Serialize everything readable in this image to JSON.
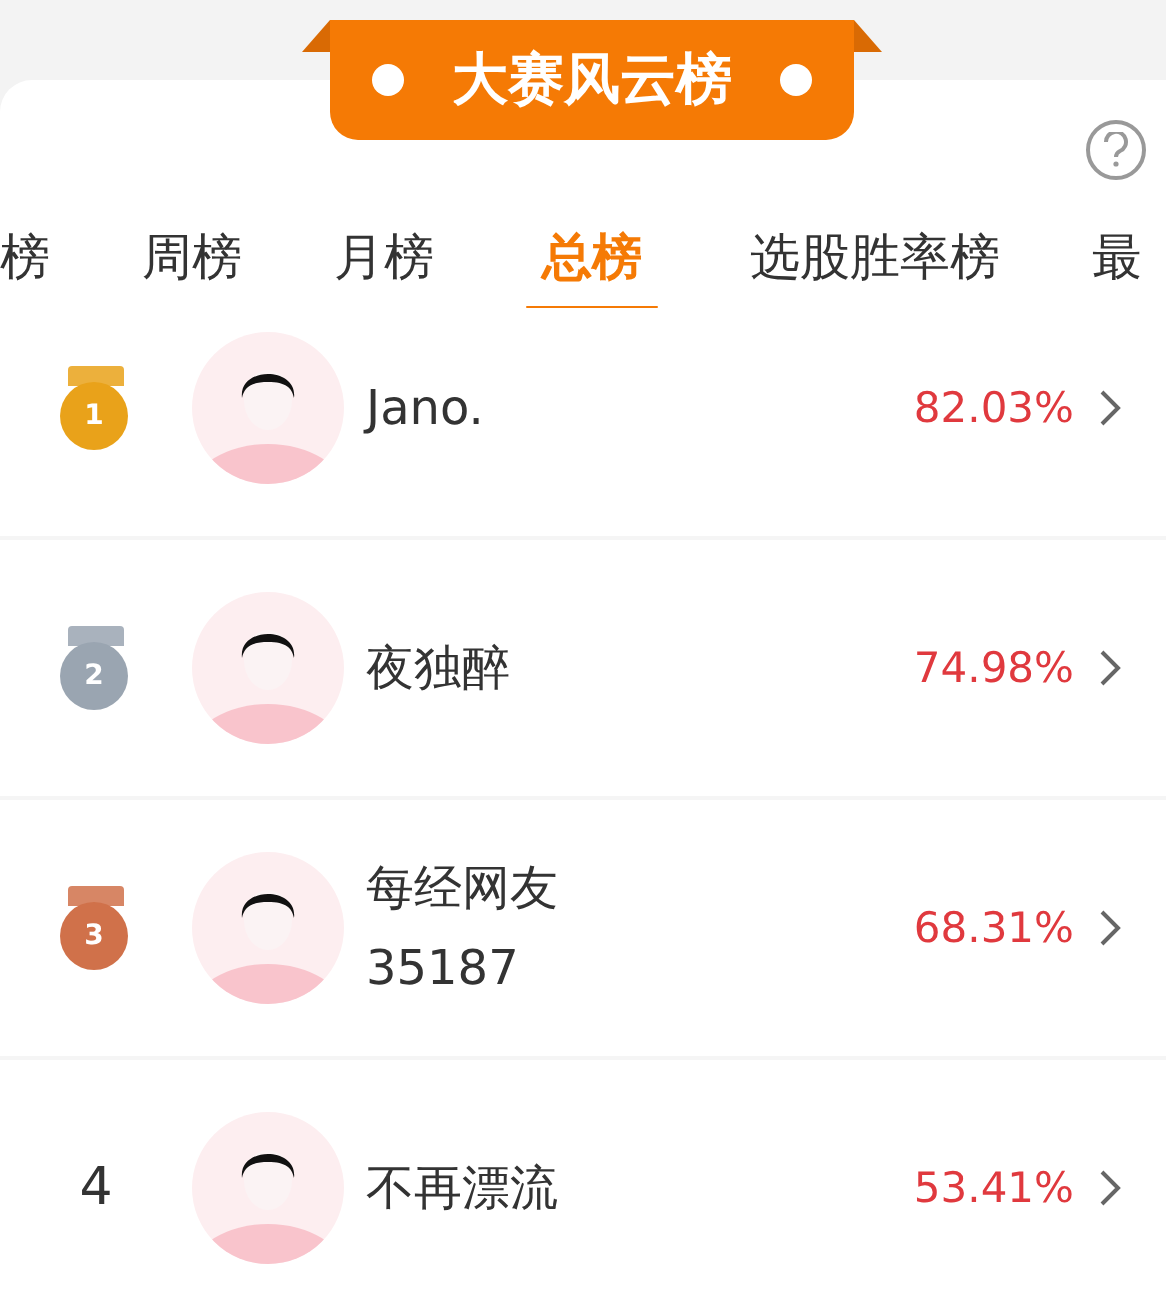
{
  "banner": {
    "title": "大赛风云榜"
  },
  "tabs": [
    {
      "label": "榜",
      "selected": false
    },
    {
      "label": "周榜",
      "selected": false
    },
    {
      "label": "月榜",
      "selected": false
    },
    {
      "label": "总榜",
      "selected": true
    },
    {
      "label": "选股胜率榜",
      "selected": false
    },
    {
      "label": "最",
      "selected": false
    }
  ],
  "rows": [
    {
      "kind": "medal",
      "rank": "1",
      "color": "#e9a21a",
      "name": "Jano.",
      "value": "82.03%"
    },
    {
      "kind": "medal",
      "rank": "2",
      "color": "#9aa5b1",
      "name": "夜独醉",
      "value": "74.98%"
    },
    {
      "kind": "medal",
      "rank": "3",
      "color": "#d0714a",
      "name": "每经网友\n35187",
      "value": "68.31%"
    },
    {
      "kind": "number",
      "rank": "4",
      "name": "不再漂流",
      "value": "53.41%"
    }
  ]
}
